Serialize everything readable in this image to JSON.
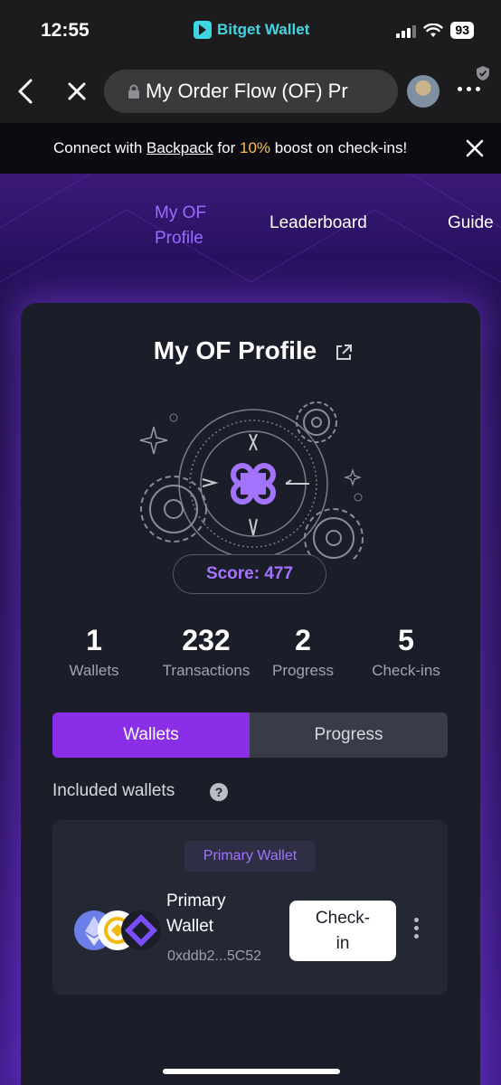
{
  "status_bar": {
    "time": "12:55",
    "app_name": "Bitget Wallet",
    "battery": "93"
  },
  "browser": {
    "url_title": "My Order Flow (OF) Pr"
  },
  "banner": {
    "prefix": "Connect with ",
    "link": "Backpack",
    "middle": " for ",
    "highlight": "10%",
    "suffix": " boost on check-ins!"
  },
  "nav_tabs": [
    {
      "label": "My OF Profile",
      "line1": "My OF",
      "line2": "Profile",
      "active": true
    },
    {
      "label": "Leaderboard",
      "active": false
    },
    {
      "label": "Guide",
      "active": false
    }
  ],
  "profile": {
    "title": "My OF Profile",
    "score_label": "Score: 477"
  },
  "stats": [
    {
      "value": "1",
      "label": "Wallets"
    },
    {
      "value": "232",
      "label": "Transactions"
    },
    {
      "value": "2",
      "label": "Progress"
    },
    {
      "value": "5",
      "label": "Check-ins"
    }
  ],
  "segment": {
    "wallets": "Wallets",
    "progress": "Progress"
  },
  "included_wallets_label": "Included wallets",
  "wallet": {
    "badge": "Primary Wallet",
    "name_line1": "Primary",
    "name_line2": "Wallet",
    "address": "0xddb2...5C52",
    "checkin_line1": "Check-",
    "checkin_line2": "in"
  },
  "colors": {
    "accent_purple": "#8a2ee8",
    "score_purple": "#a373ff",
    "banner_highlight": "#f5c14c",
    "app_cyan": "#3ed6e0"
  }
}
